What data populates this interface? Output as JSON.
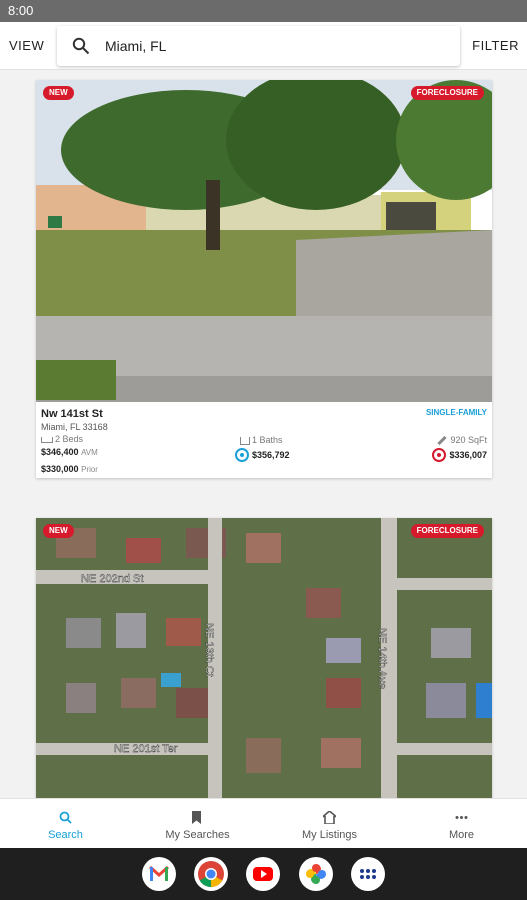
{
  "status_bar": {
    "time": "8:00"
  },
  "top_bar": {
    "view_label": "VIEW",
    "search_value": "Miami, FL",
    "filter_label": "FILTER"
  },
  "listings": [
    {
      "badge_new": "NEW",
      "badge_status": "FORECLOSURE",
      "street": "Nw 141st St",
      "city": "Miami, FL 33168",
      "property_type": "SINGLE-FAMILY",
      "beds": "2 Beds",
      "baths": "1 Baths",
      "sqft": "920 SqFt",
      "avm_value": "$346,400",
      "avm_label": "AVM",
      "prior_value": "$330,000",
      "prior_label": "Prior",
      "estimate_1": "$356,792",
      "estimate_2": "$336,007"
    },
    {
      "badge_new": "NEW",
      "badge_status": "FORECLOSURE",
      "street_labels": [
        "NE 202nd St",
        "NE 13th Ct",
        "NE 14th Ave",
        "NE 201st Ter"
      ]
    }
  ],
  "bottom_nav": [
    {
      "label": "Search",
      "icon": "search-icon"
    },
    {
      "label": "My Searches",
      "icon": "bookmark-icon"
    },
    {
      "label": "My Listings",
      "icon": "home-icon"
    },
    {
      "label": "More",
      "icon": "more-icon"
    }
  ],
  "taskbar_apps": [
    "gmail-icon",
    "chrome-icon",
    "youtube-icon",
    "photos-icon",
    "app-drawer-icon"
  ],
  "colors": {
    "accent": "#1aa0d8",
    "badge_red": "#d7192c"
  }
}
